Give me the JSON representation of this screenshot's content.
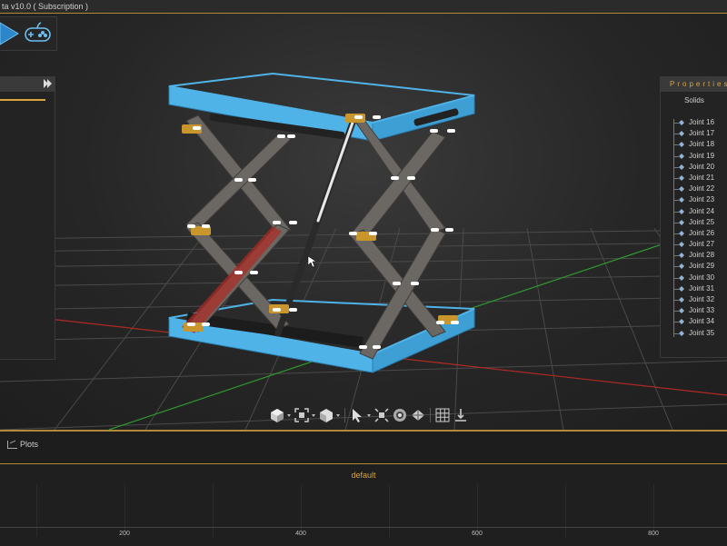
{
  "titlebar": {
    "title": "ta v10.0 ( Subscription )"
  },
  "properties": {
    "title": "Properties",
    "tab": "Solids",
    "joints": [
      "Joint 16",
      "Joint 17",
      "Joint 18",
      "Joint 19",
      "Joint 20",
      "Joint 21",
      "Joint 22",
      "Joint 23",
      "Joint 24",
      "Joint 25",
      "Joint 26",
      "Joint 27",
      "Joint 28",
      "Joint 29",
      "Joint 30",
      "Joint 31",
      "Joint 32",
      "Joint 33",
      "Joint 34",
      "Joint 35"
    ]
  },
  "bottom": {
    "tab": "Plots",
    "plot_title": "default",
    "x_ticks": [
      "200",
      "400",
      "600",
      "800"
    ]
  },
  "colors": {
    "accent": "#d9a441",
    "frame": "#4fb3e8",
    "linkage": "#6b6864",
    "pin": "#c9962e"
  }
}
